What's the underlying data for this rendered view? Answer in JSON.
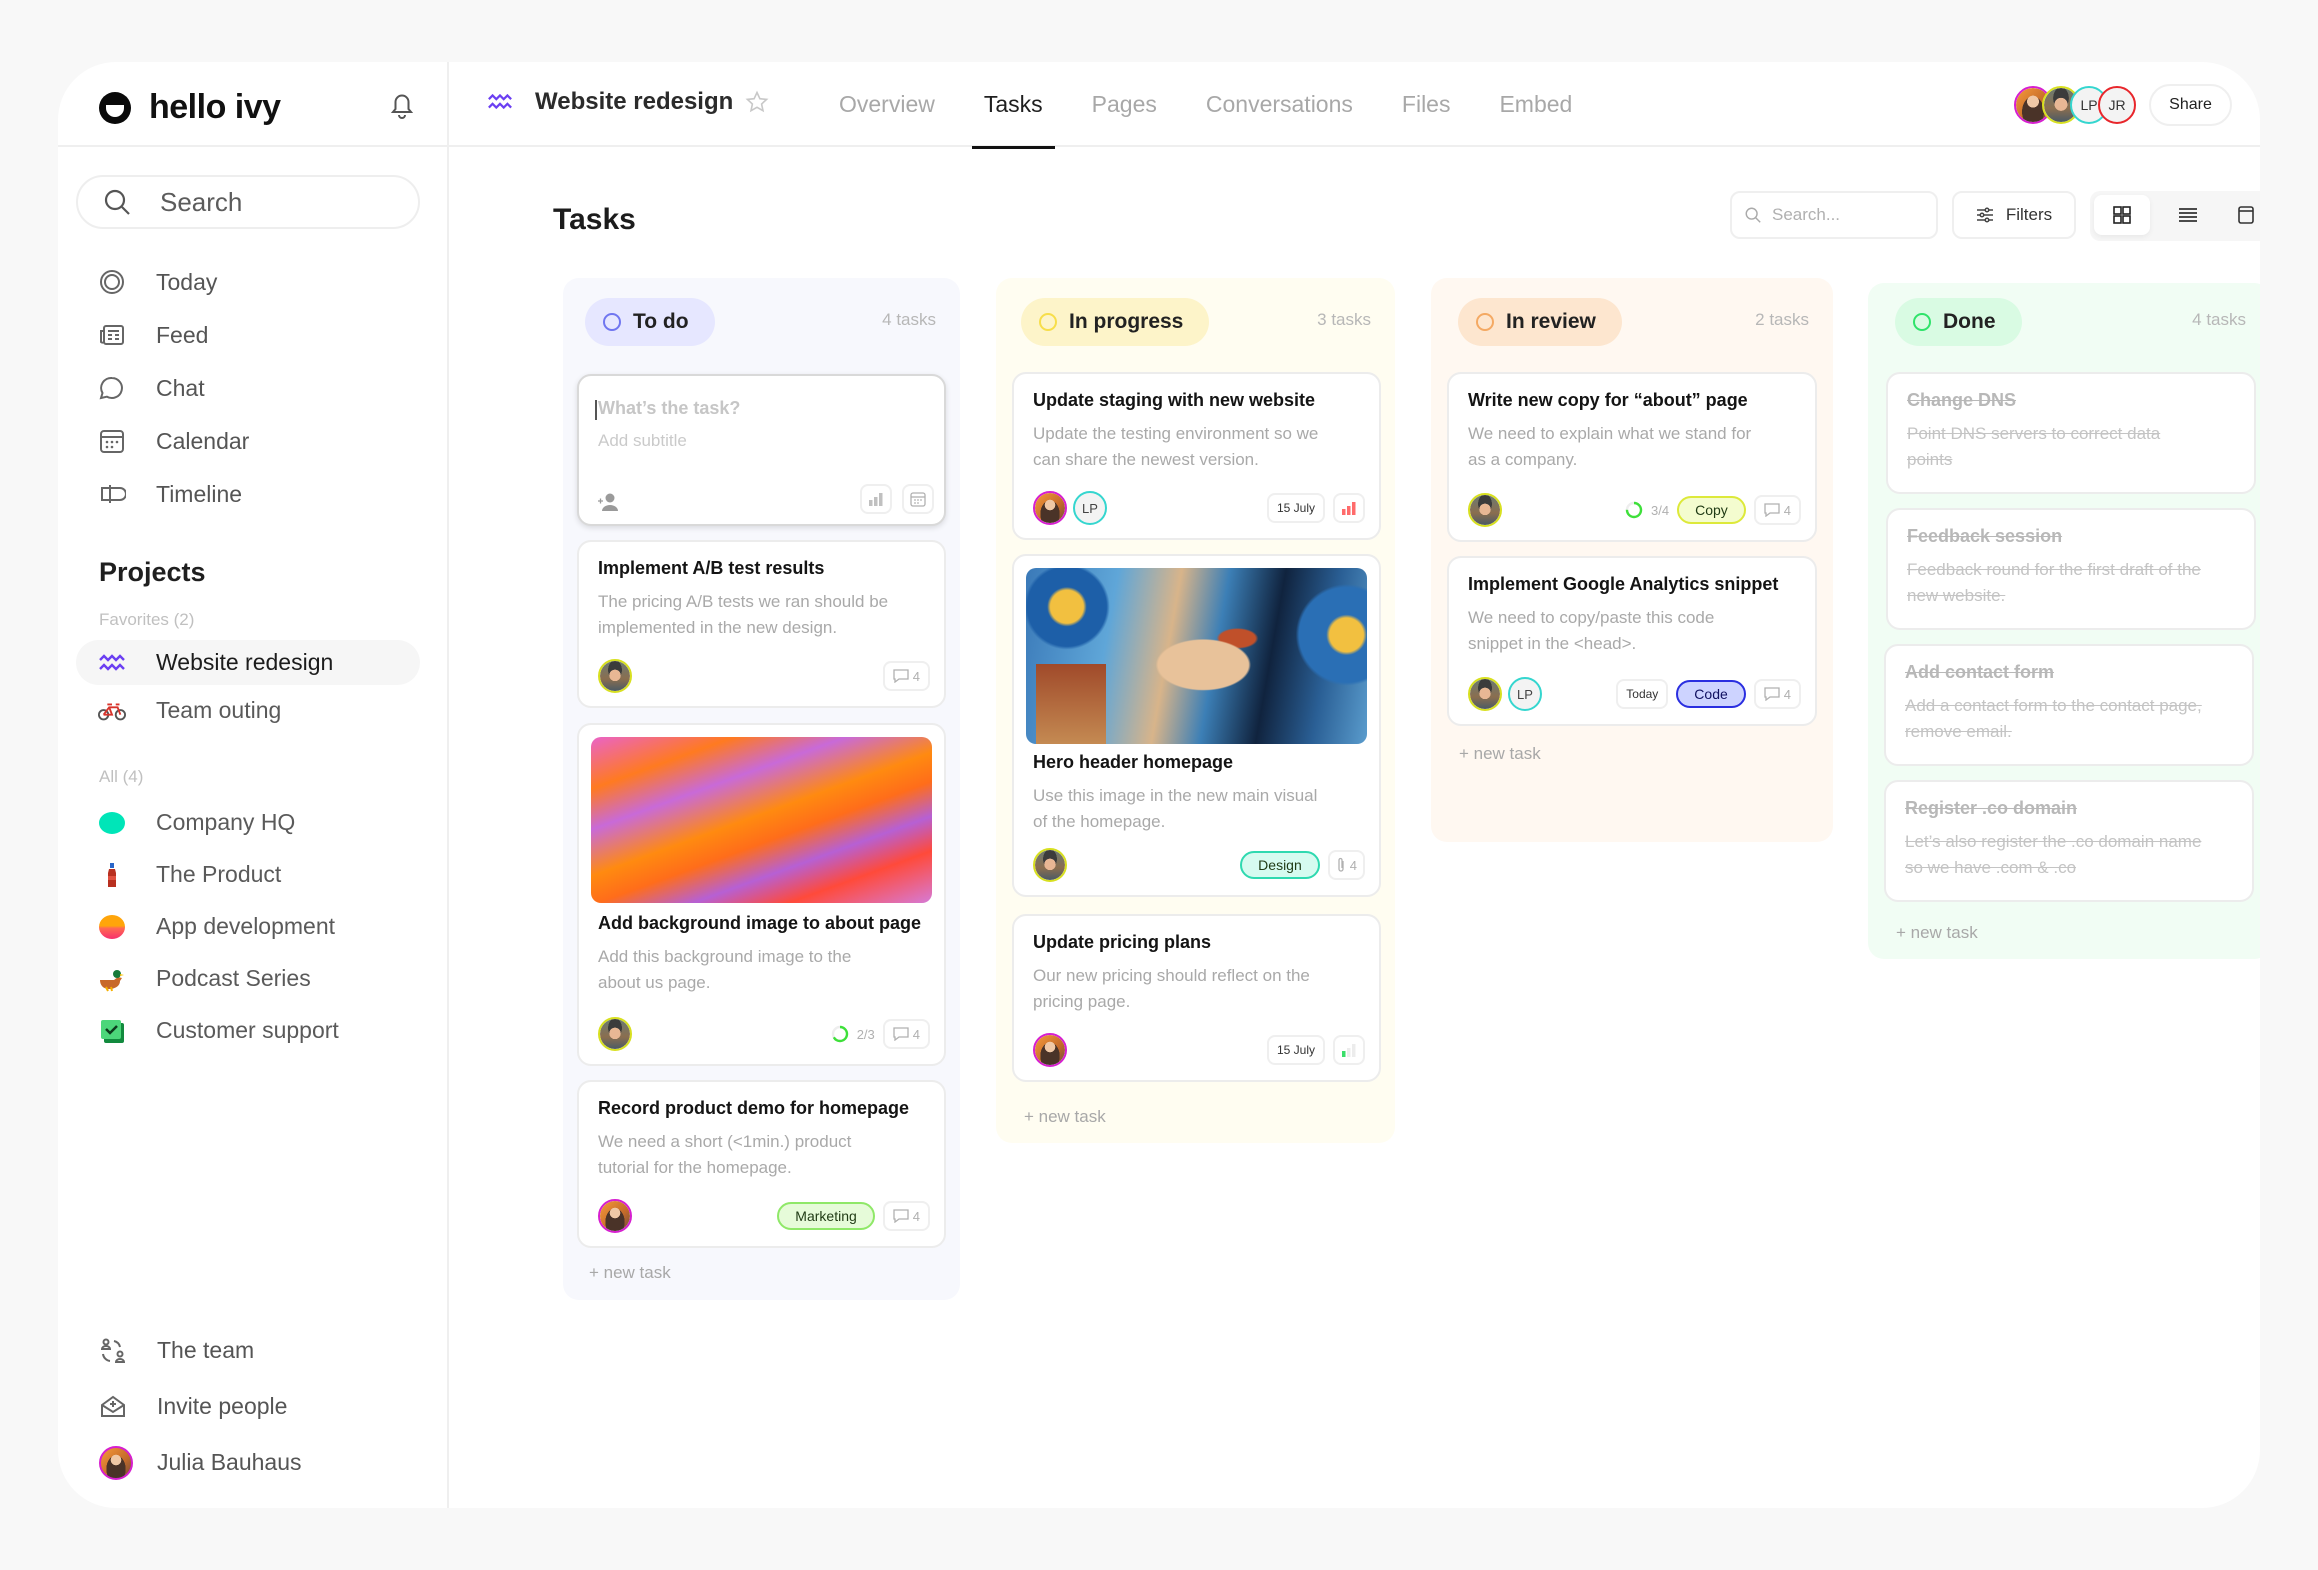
{
  "sidebar": {
    "brand": "hello ivy",
    "search_placeholder": "Search",
    "nav": [
      {
        "label": "Today",
        "icon": "target-icon"
      },
      {
        "label": "Feed",
        "icon": "newspaper-icon"
      },
      {
        "label": "Chat",
        "icon": "chat-bubble-icon"
      },
      {
        "label": "Calendar",
        "icon": "calendar-icon"
      },
      {
        "label": "Timeline",
        "icon": "timeline-icon"
      }
    ],
    "projects_title": "Projects",
    "favorites_label": "Favorites (2)",
    "favorites": [
      {
        "label": "Website redesign",
        "icon": "wave-icon",
        "active": true
      },
      {
        "label": "Team outing",
        "icon": "bicycle-icon"
      }
    ],
    "all_label": "All (4)",
    "all": [
      {
        "label": "Company HQ",
        "icon": "teal-dot-icon",
        "color": "#00e5b8"
      },
      {
        "label": "The Product",
        "icon": "bottle-icon"
      },
      {
        "label": "App development",
        "icon": "sunset-icon"
      },
      {
        "label": "Podcast Series",
        "icon": "duck-icon"
      },
      {
        "label": "Customer support",
        "icon": "check-box-icon"
      }
    ],
    "bottom": [
      {
        "label": "The team",
        "icon": "team-icon"
      },
      {
        "label": "Invite people",
        "icon": "invite-envelope-icon"
      },
      {
        "label": "Julia Bauhaus",
        "icon": "user-avatar"
      }
    ]
  },
  "header": {
    "project_name": "Website redesign",
    "tabs": [
      {
        "label": "Overview"
      },
      {
        "label": "Tasks",
        "active": true
      },
      {
        "label": "Pages"
      },
      {
        "label": "Conversations"
      },
      {
        "label": "Files"
      },
      {
        "label": "Embed"
      }
    ],
    "members": [
      {
        "initials": "",
        "ring": "#d61fd0",
        "photo": "julia"
      },
      {
        "initials": "",
        "ring": "#d8e020",
        "photo": "man"
      },
      {
        "initials": "LP",
        "ring": "#35d6cf"
      },
      {
        "initials": "JR",
        "ring": "#e8262b"
      }
    ],
    "share_label": "Share"
  },
  "page": {
    "title": "Tasks",
    "search_placeholder": "Search...",
    "filters_label": "Filters",
    "views": [
      "grid-view",
      "list-view",
      "calendar-view"
    ],
    "active_view": "grid-view"
  },
  "board": {
    "new_task_label": "+ new task",
    "columns": [
      {
        "name": "To do",
        "count": "4 tasks",
        "ring": "#7076f0",
        "pill": "#e6e7ff",
        "bg": "#f7f8fd",
        "draft": {
          "title_placeholder": "What’s the task?",
          "subtitle_placeholder": "Add subtitle"
        },
        "cards": [
          {
            "title": "Implement A/B test results",
            "desc": "The pricing A/B tests we ran should be implemented in the new design.",
            "assignees": [
              "man"
            ],
            "comments": "4"
          },
          {
            "title": "Add background image to about page",
            "desc": "Add this background image to the about us page.",
            "assignees": [
              "man"
            ],
            "progress": "2/3",
            "progress_value": 0.67,
            "comments": "4",
            "image": "watercolor"
          },
          {
            "title": "Record product demo for homepage",
            "desc": "We need a short (<1min.) product tutorial for the homepage.",
            "assignees": [
              "julia"
            ],
            "tag": {
              "label": "Marketing",
              "bg": "#e6fbd9",
              "border": "#8fe868"
            },
            "comments": "4"
          }
        ]
      },
      {
        "name": "In progress",
        "count": "3 tasks",
        "ring": "#f7de4a",
        "pill": "#fdf4c9",
        "bg": "#fffdf1",
        "cards": [
          {
            "title": "Update staging with new website",
            "desc": "Update the testing environment so we can share the newest version.",
            "assignees": [
              "julia",
              "LP"
            ],
            "due": "15 July",
            "priority": "high"
          },
          {
            "title": "Hero header homepage",
            "desc": "Use this image in the new main visual of the homepage.",
            "assignees": [
              "man"
            ],
            "tag": {
              "label": "Design",
              "bg": "#d6fbf0",
              "border": "#2fd9b0"
            },
            "attachments": "4",
            "image": "mosaic"
          },
          {
            "title": "Update pricing plans",
            "desc": "Our new pricing should reflect on the pricing page.",
            "assignees": [
              "julia"
            ],
            "due": "15 July",
            "priority": "low"
          }
        ]
      },
      {
        "name": "In review",
        "count": "2 tasks",
        "ring": "#f4a963",
        "pill": "#fde6cf",
        "bg": "#fff8f1",
        "cards": [
          {
            "title": "Write new copy for “about” page",
            "desc": "We need to explain what we stand for as a company.",
            "assignees": [
              "man"
            ],
            "progress": "3/4",
            "progress_value": 0.75,
            "tag": {
              "label": "Copy",
              "bg": "#f4fccf",
              "border": "#dde93a"
            },
            "comments": "4"
          },
          {
            "title": "Implement Google Analytics snippet",
            "desc": "We need to copy/paste this code snippet in the <head>.",
            "assignees": [
              "man",
              "LP"
            ],
            "due": "Today",
            "tag": {
              "label": "Code",
              "bg": "#cdd3ff",
              "border": "#2a2ee0"
            },
            "comments": "4"
          }
        ]
      },
      {
        "name": "Done",
        "count": "4 tasks",
        "ring": "#2fe36a",
        "pill": "#d9fbe3",
        "bg": "#f1fdf4",
        "cards": [
          {
            "title": "Change DNS",
            "desc": "Point DNS servers to correct data points"
          },
          {
            "title": "Feedback session",
            "desc": "Feedback round for the first draft of the new website."
          },
          {
            "title": "Add contact form",
            "desc": "Add a contact form to the contact page, remove email."
          },
          {
            "title": "Register .co domain",
            "desc": "Let’s also register the .co domain name so we have .com & .co"
          }
        ]
      }
    ]
  }
}
